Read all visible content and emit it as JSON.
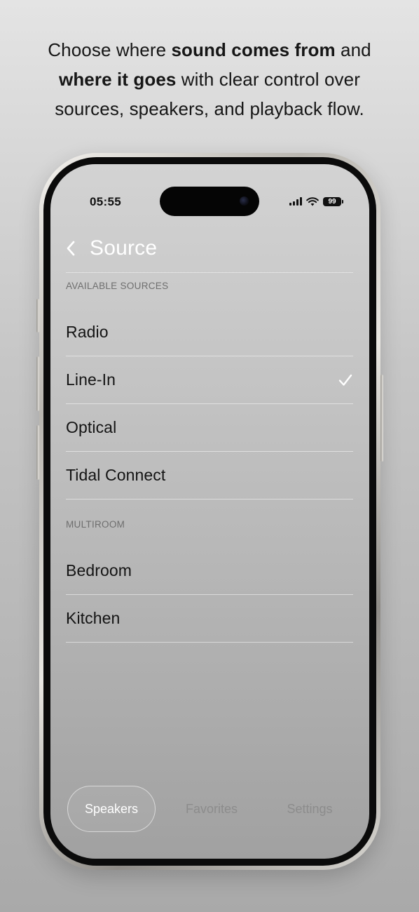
{
  "headline": {
    "line1_pre": "Choose where ",
    "line1_bold": "sound comes from",
    "line1_post": " and",
    "line2_bold": "where it goes",
    "line2_post": " with clear control over",
    "line3": "sources, speakers, and playback flow."
  },
  "status_bar": {
    "time": "05:55",
    "battery": "99",
    "icons": [
      "cellular-signal-icon",
      "wifi-icon",
      "battery-icon"
    ]
  },
  "header": {
    "title": "Source",
    "back_icon": "chevron-left-icon"
  },
  "sections": [
    {
      "label": "AVAILABLE SOURCES",
      "items": [
        {
          "label": "Radio",
          "selected": false
        },
        {
          "label": "Line-In",
          "selected": true
        },
        {
          "label": "Optical",
          "selected": false
        },
        {
          "label": "Tidal Connect",
          "selected": false
        }
      ]
    },
    {
      "label": "MULTIROOM",
      "items": [
        {
          "label": "Bedroom",
          "selected": false
        },
        {
          "label": "Kitchen",
          "selected": false
        }
      ]
    }
  ],
  "tabs": [
    {
      "label": "Speakers",
      "active": true
    },
    {
      "label": "Favorites",
      "active": false
    },
    {
      "label": "Settings",
      "active": false
    }
  ],
  "colors": {
    "title": "#ffffff",
    "row_text": "#141414",
    "section_label": "#6e6e6e",
    "tab_inactive": "#8c8c8c",
    "tab_active": "#ffffff"
  }
}
